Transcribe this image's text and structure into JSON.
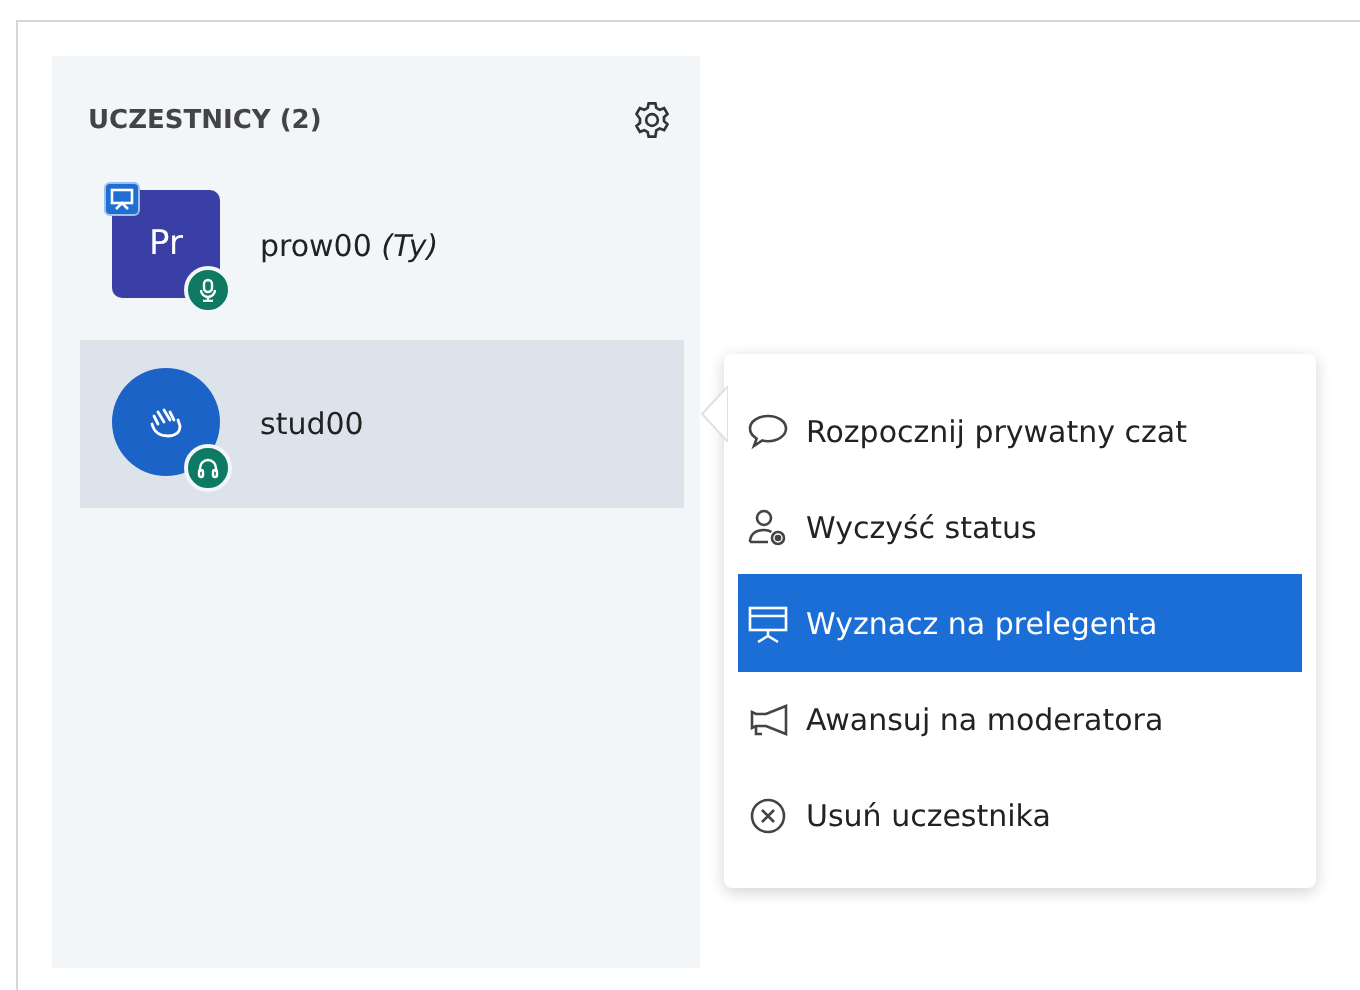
{
  "participants_panel": {
    "title": "UCZESTNICY (2)",
    "participants": [
      {
        "name": "prow00 *(Ty)*",
        "avatar": {
          "kind": "initials",
          "initials": "Pr",
          "color": "#3a3fa6"
        },
        "presenter": true,
        "audio_badge": {
          "kind": "microphone"
        },
        "selected": false
      },
      {
        "name": "stud00",
        "avatar": {
          "kind": "raised-hand",
          "color": "#1b63c6"
        },
        "presenter": false,
        "audio_badge": {
          "kind": "headphones"
        },
        "selected": true
      }
    ]
  },
  "context_menu": {
    "items": [
      {
        "kind": "chat",
        "label": "Rozpocznij prywatny czat",
        "selected": false
      },
      {
        "kind": "clear-status",
        "label": "Wyczyść status",
        "selected": false
      },
      {
        "kind": "presenter",
        "label": "Wyznacz na prelegenta",
        "selected": true
      },
      {
        "kind": "promote",
        "label": "Awansuj na moderatora",
        "selected": false
      },
      {
        "kind": "remove",
        "label": "Usuń uczestnika",
        "selected": false
      }
    ]
  }
}
